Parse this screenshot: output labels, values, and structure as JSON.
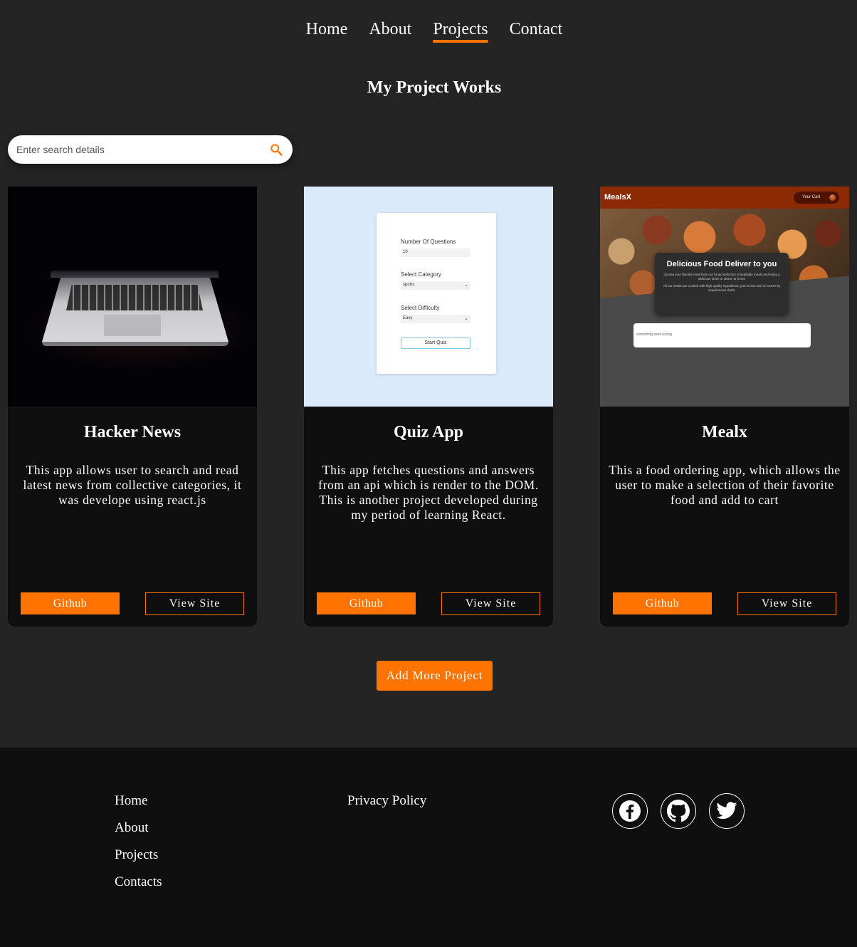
{
  "nav": {
    "items": [
      {
        "label": "Home",
        "active": false
      },
      {
        "label": "About",
        "active": false
      },
      {
        "label": "Projects",
        "active": true
      },
      {
        "label": "Contact",
        "active": false
      }
    ],
    "accent_color": "#ff7400"
  },
  "page_title": "My Project Works",
  "search": {
    "placeholder": "Enter search details",
    "value": "",
    "icon": "search-icon"
  },
  "projects": [
    {
      "title": "Hacker News",
      "description": "This app allows user to search and read latest news from collective categories, it was develope using react.js",
      "github_label": "Github",
      "view_label": "View Site",
      "thumbnail": "laptop-in-dark"
    },
    {
      "title": "Quiz App",
      "description": "This app fetches questions and answers from an api which is render to the DOM. This is another project developed during my period of learning React.",
      "github_label": "Github",
      "view_label": "View Site",
      "thumbnail": "quiz-setup-form",
      "preview": {
        "q_label": "Number Of Questions",
        "q_value": "10",
        "cat_label": "Select Category",
        "cat_value": "sports",
        "diff_label": "Select Difficulty",
        "diff_value": "Easy",
        "start_label": "Start Quiz"
      }
    },
    {
      "title": "Mealx",
      "description": "This a food ordering app, which allows the user to make a selection of their favorite food and add to cart",
      "github_label": "Github",
      "view_label": "View Site",
      "thumbnail": "food-ordering-site",
      "preview": {
        "brand": "MealsX",
        "cart_label": "Your Cart",
        "cart_count": "0",
        "hero_title": "Delicious Food Deliver to you",
        "hero_text1": "choose your favorite meal from our broad selection of available meals and enjoy a delicious lunch or dinner at home",
        "hero_text2": "All our meals are cooked with high quality ingredients, just in time and of course by experienced chefs!",
        "error_text": "something went wrong"
      }
    }
  ],
  "add_button": "Add More Project",
  "footer": {
    "links": [
      "Home",
      "About",
      "Projects",
      "Contacts"
    ],
    "policy": "Privacy Policy",
    "social": [
      "facebook-icon",
      "github-icon",
      "twitter-icon"
    ]
  }
}
